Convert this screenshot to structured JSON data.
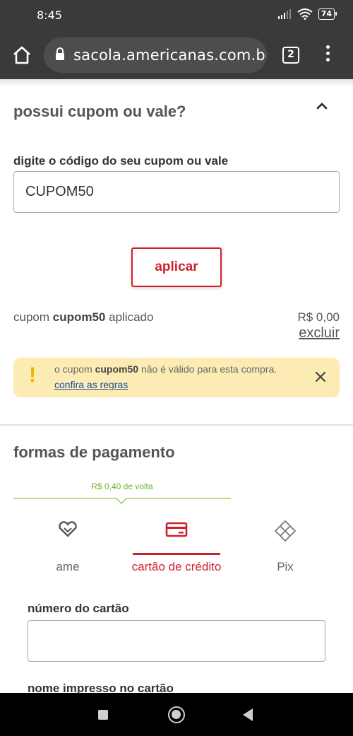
{
  "status_bar": {
    "time": "8:45",
    "battery": "74"
  },
  "browser": {
    "url": "sacola.americanas.com.br/",
    "tab_count": "2"
  },
  "coupon": {
    "title": "possui cupom ou vale?",
    "input_label": "digite o código do seu cupom ou vale",
    "input_value": "CUPOM50",
    "apply_label": "aplicar",
    "applied_prefix": "cupom ",
    "applied_code": "cupom50",
    "applied_suffix": " aplicado",
    "applied_value": "R$ 0,00",
    "remove_label": "excluir"
  },
  "warning": {
    "text_prefix": "o cupom ",
    "code": "cupom50",
    "text_suffix": " não é válido para esta compra.",
    "rules_link": "confira as regras",
    "icon_color": "#f0b400",
    "background": "#fcecb4"
  },
  "payment": {
    "title": "formas de pagamento",
    "cashback": "R$ 0,40   de volta",
    "tabs": [
      {
        "label": "ame",
        "icon": "ame-heart-icon",
        "selected": false
      },
      {
        "label": "cartão de crédito",
        "icon": "credit-card-icon",
        "selected": true
      },
      {
        "label": "Pix",
        "icon": "pix-icon",
        "selected": false
      }
    ],
    "accent_color": "#d0202d",
    "card_number_label": "número do cartão",
    "card_name_label": "nome impresso no cartão"
  }
}
